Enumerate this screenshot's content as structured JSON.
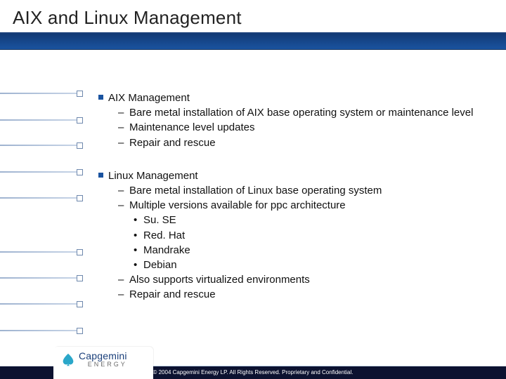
{
  "title": "AIX and Linux Management",
  "sections": [
    {
      "heading": "AIX Management",
      "items": [
        {
          "text": "Bare metal installation of AIX base operating system or maintenance  level"
        },
        {
          "text": "Maintenance level updates"
        },
        {
          "text": "Repair and rescue"
        }
      ]
    },
    {
      "heading": "Linux Management",
      "items": [
        {
          "text": "Bare metal installation of Linux base operating system"
        },
        {
          "text": "Multiple versions available for ppc architecture",
          "sub": [
            "Su. SE",
            "Red. Hat",
            "Mandrake",
            "Debian"
          ]
        },
        {
          "text": "Also supports virtualized environments"
        },
        {
          "text": "Repair and rescue"
        }
      ]
    }
  ],
  "rail_line_tops": [
    62,
    100,
    136,
    174,
    211,
    288,
    325,
    362,
    400
  ],
  "footer": {
    "copyright": "© 2004 Capgemini Energy LP.  All Rights Reserved.  Proprietary and Confidential.",
    "logo_main": "Capgemini",
    "logo_sub": "ENERGY"
  }
}
